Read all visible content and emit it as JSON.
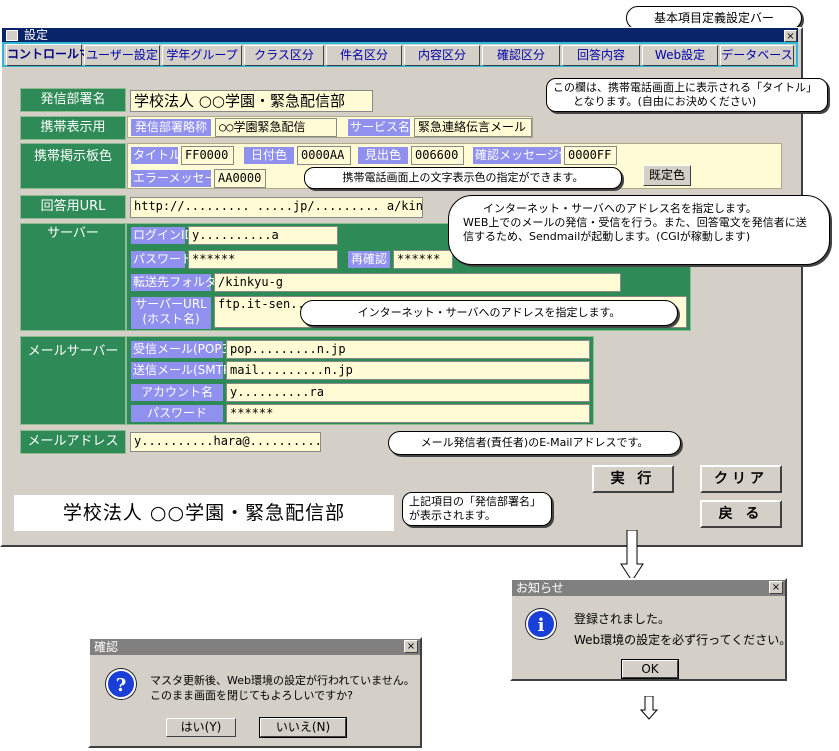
{
  "window": {
    "title": "設定",
    "close": "×"
  },
  "top_callout": "基本項目定義設定バー",
  "tabs": [
    "コントロールマスタ",
    "ユーザー設定",
    "学年グループ",
    "クラス区分",
    "件名区分",
    "内容区分",
    "確認区分",
    "回答内容",
    "Web設定",
    "データベース"
  ],
  "form": {
    "sender_label": "発信部署名",
    "sender_value": "学校法人 ○○学園・緊急配信部",
    "mobile_label": "携帯表示用",
    "abbr_label": "発信部署略称",
    "abbr_value": "○○学園緊急配信",
    "service_label": "サービス名",
    "service_value": "緊急連絡伝言メール",
    "board_label": "携帯掲示板色",
    "title_color_label": "タイトル色",
    "title_color_value": "FF0000",
    "date_color_label": "日付色",
    "date_color_value": "0000AA",
    "heading_color_label": "見出色",
    "heading_color_value": "006600",
    "confirm_color_label": "確認メッセージ色",
    "confirm_color_value": "0000FF",
    "error_color_label": "エラーメッセージ色",
    "error_color_value": "AA0000",
    "default_color_button": "既定色",
    "url_label": "回答用URL",
    "url_value": "http://......... .....jp/......... a/kinkyu-g/",
    "server_label": "サーバー",
    "login_label": "ログインID",
    "login_value": "y..........a",
    "password_label": "パスワード",
    "password_value": "******",
    "reconfirm_label": "再確認",
    "reconfirm_value": "******",
    "folder_label": "転送先フォルダ",
    "folder_value": "/kinkyu-g",
    "server_url_label_1": "サーバーURL",
    "server_url_label_2": "(ホスト名)",
    "server_url_value": "ftp.it-sen...",
    "mail_server_label": "メールサーバー",
    "pop3_label": "受信メール(POP3)",
    "pop3_value": "pop.........n.jp",
    "smtp_label": "送信メール(SMTP)",
    "smtp_value": "mail.........n.jp",
    "account_label": "アカウント名",
    "account_value": "y..........ra",
    "mail_password_label": "パスワード",
    "mail_password_value": "******",
    "mail_address_label": "メールアドレス",
    "mail_address_value": "y..........hara@..........jp"
  },
  "buttons": {
    "execute": "実 行",
    "clear": "クリア",
    "back": "戻 る"
  },
  "preview": "学校法人 ○○学園・緊急配信部",
  "callouts": {
    "title_note_1": "この欄は、携帯電話画面上に表示される「タイトル」",
    "title_note_2": "となります。(自由にお決めください)",
    "color_note": "携帯電話画面上の文字表示色の指定ができます。",
    "url_note_1": "インターネット・サーバへのアドレス名を指定します。",
    "url_note_2": "WEB上でのメールの発信・受信を行う。また、回答電文を発信者に送",
    "url_note_3": "信するため、Sendmailが起動します。(CGIが稼動します)",
    "server_note": "インターネット・サーバへのアドレスを指定します。",
    "mail_note": "メール発信者(責任者)のE-Mailアドレスです。",
    "preview_note_1": "上記項目の「発信部署名」",
    "preview_note_2": "が表示されます。"
  },
  "info_dialog": {
    "title": "お知らせ",
    "line1": "登録されました。",
    "line2": "Web環境の設定を必ず行ってください。",
    "ok": "OK"
  },
  "confirm_dialog": {
    "title": "確認",
    "line1": "マスタ更新後、Web環境の設定が行われていません。",
    "line2": "このまま画面を閉じてもよろしいですか?",
    "yes": "はい(Y)",
    "no": "いいえ(N)"
  }
}
